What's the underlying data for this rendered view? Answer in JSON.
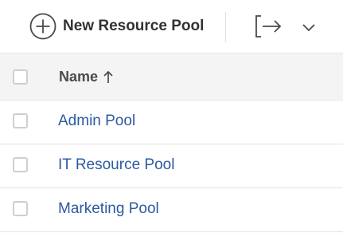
{
  "toolbar": {
    "new_label": "New Resource Pool",
    "plus_icon": "plus-circle-icon",
    "export_icon": "export-arrow-icon",
    "more_icon": "chevron-down-icon"
  },
  "table": {
    "header": {
      "name_label": "Name",
      "sort": "ascending"
    },
    "rows": [
      {
        "name": "Admin Pool"
      },
      {
        "name": "IT Resource Pool"
      },
      {
        "name": "Marketing Pool"
      }
    ]
  },
  "colors": {
    "link": "#2c5aa0",
    "header_bg": "#f4f4f4"
  }
}
